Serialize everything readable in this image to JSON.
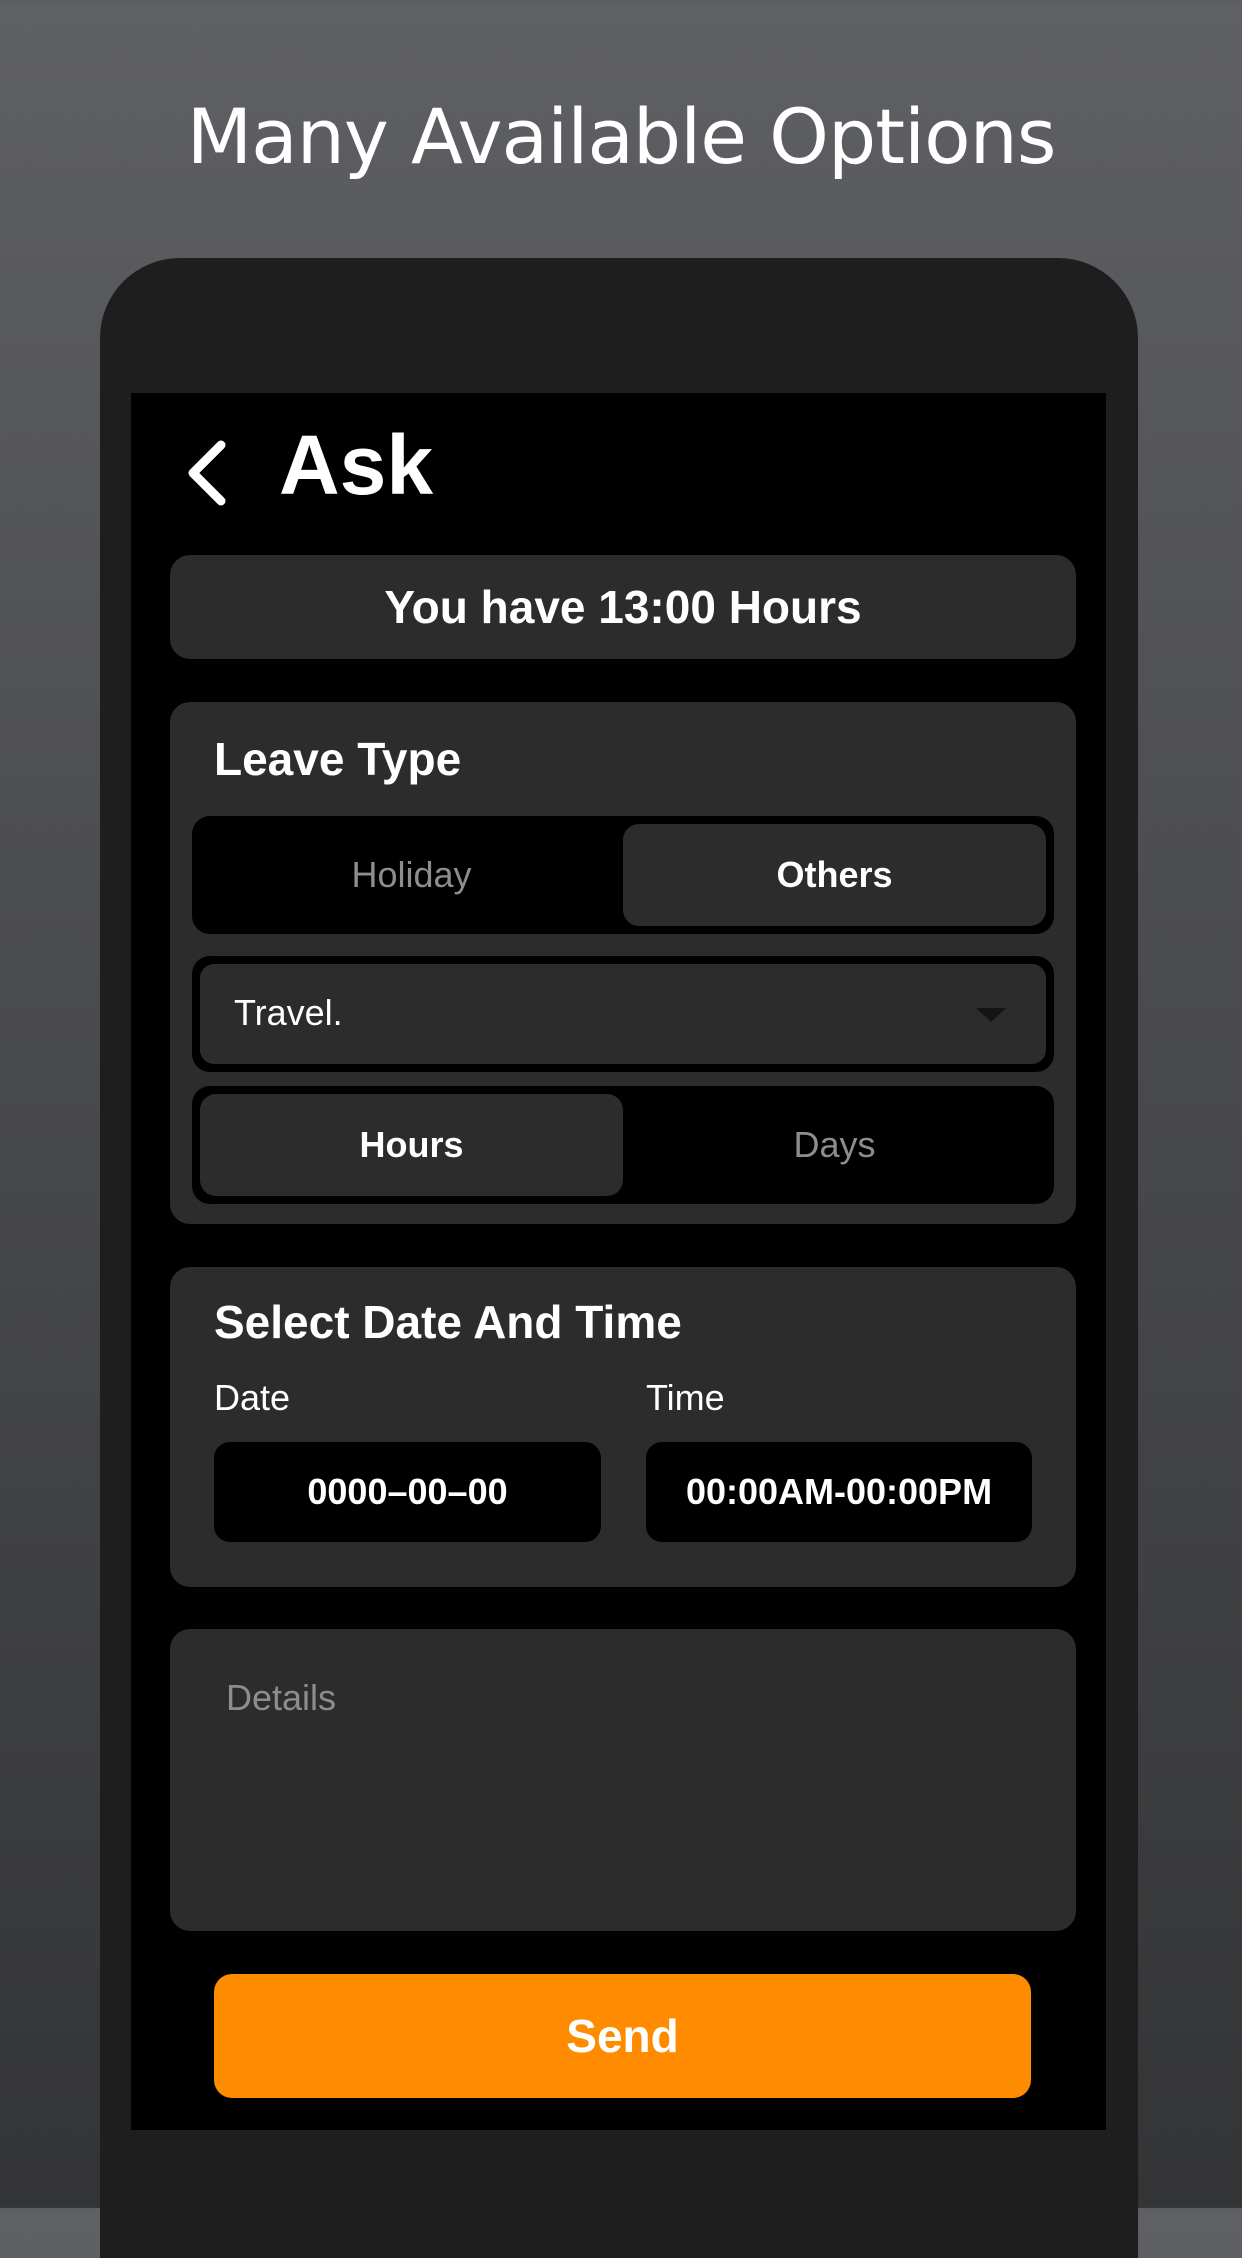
{
  "promo": {
    "headline": "Many Available Options"
  },
  "header": {
    "title": "Ask",
    "back_icon": "chevron-left-icon"
  },
  "hours_banner": {
    "text": "You have 13:00 Hours"
  },
  "leave_type": {
    "title": "Leave Type",
    "options": [
      {
        "label": "Holiday",
        "selected": false
      },
      {
        "label": "Others",
        "selected": true
      }
    ],
    "reason_selected": "Travel.",
    "dropdown_icon": "caret-down-icon",
    "unit_options": [
      {
        "label": "Hours",
        "selected": true
      },
      {
        "label": "Days",
        "selected": false
      }
    ]
  },
  "date_time": {
    "title": "Select Date And Time",
    "date_label": "Date",
    "date_value": "0000–00–00",
    "time_label": "Time",
    "time_value": "00:00AM-00:00PM"
  },
  "details": {
    "placeholder": "Details",
    "value": ""
  },
  "send": {
    "label": "Send"
  },
  "colors": {
    "accent": "#ff8c00",
    "card": "#2c2c2d",
    "screen": "#000000",
    "muted_text": "#8d8d8f"
  }
}
